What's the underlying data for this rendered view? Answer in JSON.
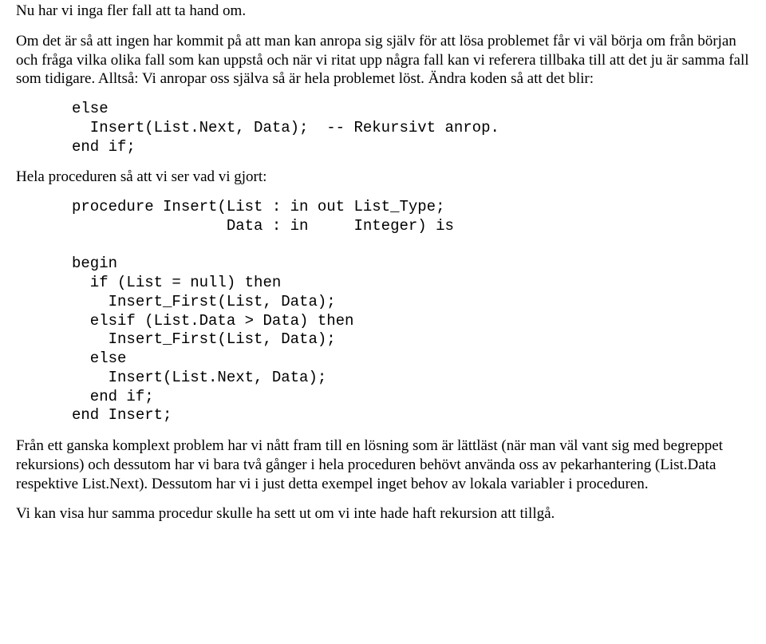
{
  "para1": "Nu har vi inga fler fall att ta hand om.",
  "para2": "Om det är så att ingen har kommit på att man kan anropa sig själv för att lösa problemet får vi väl börja om från början och fråga vilka olika fall som kan uppstå och när vi ritat upp några fall kan vi referera tillbaka till att det ju är samma fall som tidigare. Alltså: Vi anropar oss själva så är hela problemet löst. Ändra koden så att det blir:",
  "code1": "else\n  Insert(List.Next, Data);  -- Rekursivt anrop.\nend if;",
  "para3": "Hela proceduren så att vi ser vad vi gjort:",
  "code2": "procedure Insert(List : in out List_Type;\n                 Data : in     Integer) is\n\nbegin\n  if (List = null) then\n    Insert_First(List, Data);\n  elsif (List.Data > Data) then\n    Insert_First(List, Data);\n  else\n    Insert(List.Next, Data);\n  end if;\nend Insert;",
  "para4": "Från ett ganska komplext problem har vi nått fram till en lösning som är lättläst (när man väl vant sig med begreppet rekursions) och dessutom har vi bara två gånger i hela proceduren behövt använda oss av pekarhantering (List.Data respektive List.Next). Dessutom har vi i just detta exempel inget behov av lokala variabler i proceduren.",
  "para5": "Vi kan visa hur samma procedur skulle ha sett ut om vi inte hade haft rekursion att tillgå."
}
